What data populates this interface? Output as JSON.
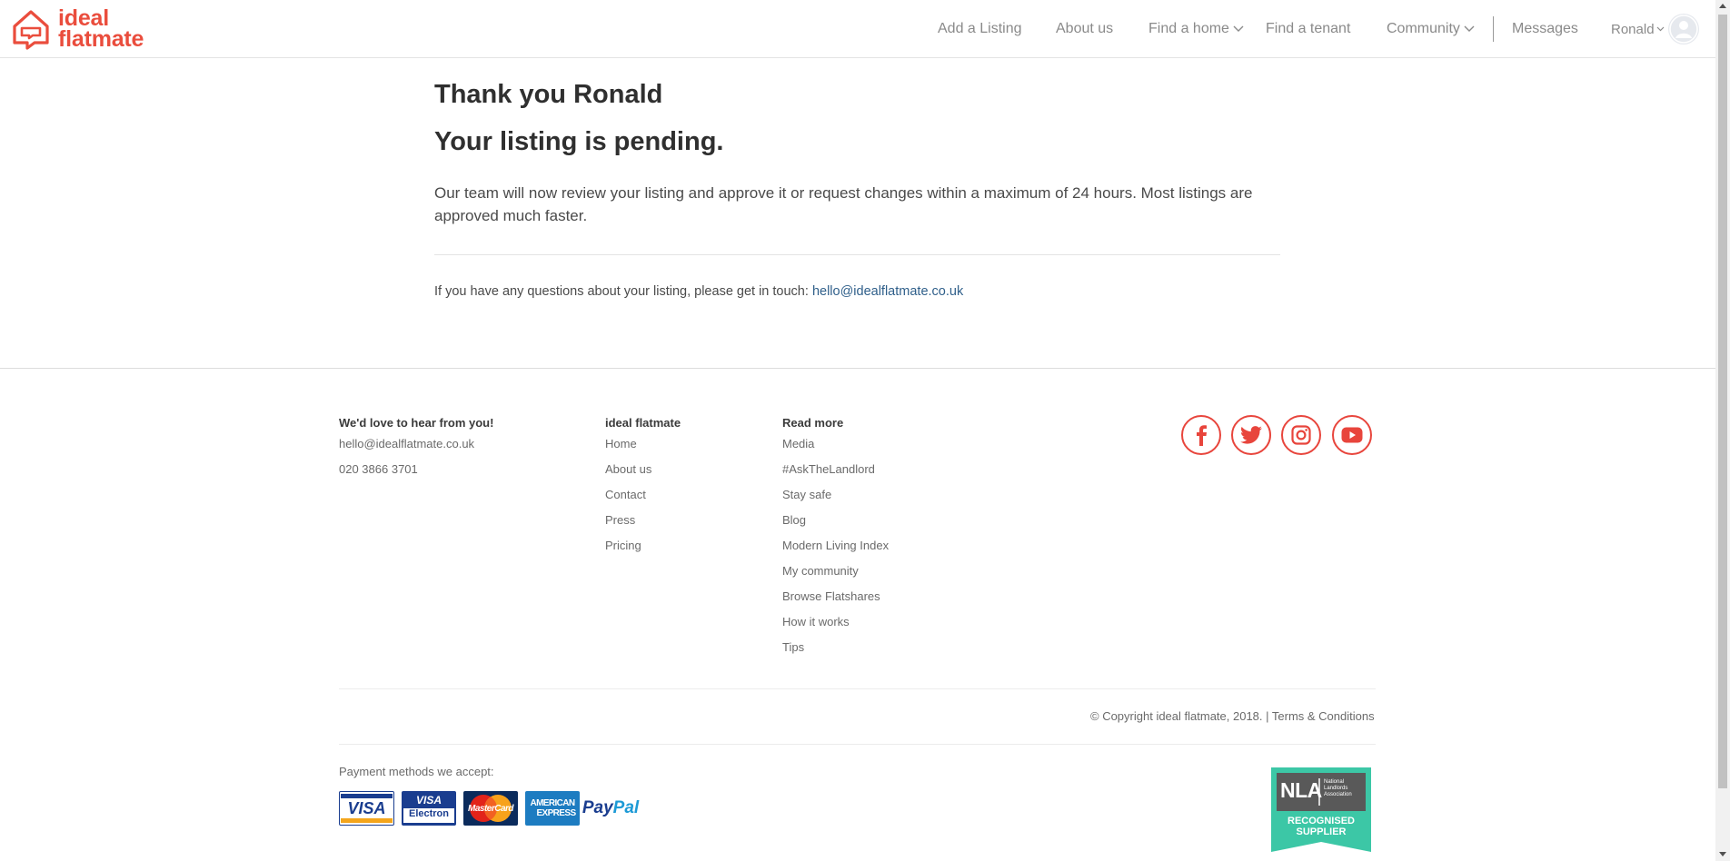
{
  "brand": {
    "logo_line1": "ideal",
    "logo_line2": "flatmate",
    "accent_color": "#ea4d3d"
  },
  "nav": {
    "add_listing": "Add a Listing",
    "about": "About us",
    "find_home": "Find a home",
    "find_tenant": "Find a tenant",
    "community": "Community",
    "messages": "Messages",
    "user": "Ronald"
  },
  "main": {
    "title": "Thank you Ronald",
    "subtitle": "Your listing is pending.",
    "body": "Our team will now review your listing and approve it or request changes within a maximum of 24 hours. Most listings are approved much faster.",
    "contact_prefix": "If you have any questions about your listing, please get in touch: ",
    "contact_email": "hello@idealflatmate.co.uk"
  },
  "footer": {
    "col1": {
      "title": "We'd love to hear from you!",
      "email": "hello@idealflatmate.co.uk",
      "phone": "020 3866 3701"
    },
    "col2": {
      "title": "ideal flatmate",
      "links": [
        "Home",
        "About us",
        "Contact",
        "Press",
        "Pricing"
      ]
    },
    "col3": {
      "title": "Read more",
      "links": [
        "Media",
        "#AskTheLandlord",
        "Stay safe",
        "Blog",
        "Modern Living Index",
        "My community",
        "Browse Flatshares",
        "How it works",
        "Tips"
      ]
    },
    "social": [
      "facebook-icon",
      "twitter-icon",
      "instagram-icon",
      "youtube-icon"
    ],
    "copyright": "© Copyright ideal flatmate, 2018. | ",
    "terms": "Terms & Conditions",
    "payment_label": "Payment methods we accept:",
    "cards": {
      "visa": "VISA",
      "visa_electron_1": "VISA",
      "visa_electron_2": "Electron",
      "mastercard": "MasterCard",
      "amex_1": "AMERICAN",
      "amex_2": "EXPRESS",
      "paypal_1": "Pay",
      "paypal_2": "Pal"
    },
    "nla": {
      "abbr": "NLA",
      "full": "National Landlords Association",
      "badge_1": "RECOGNISED",
      "badge_2": "SUPPLIER"
    }
  }
}
